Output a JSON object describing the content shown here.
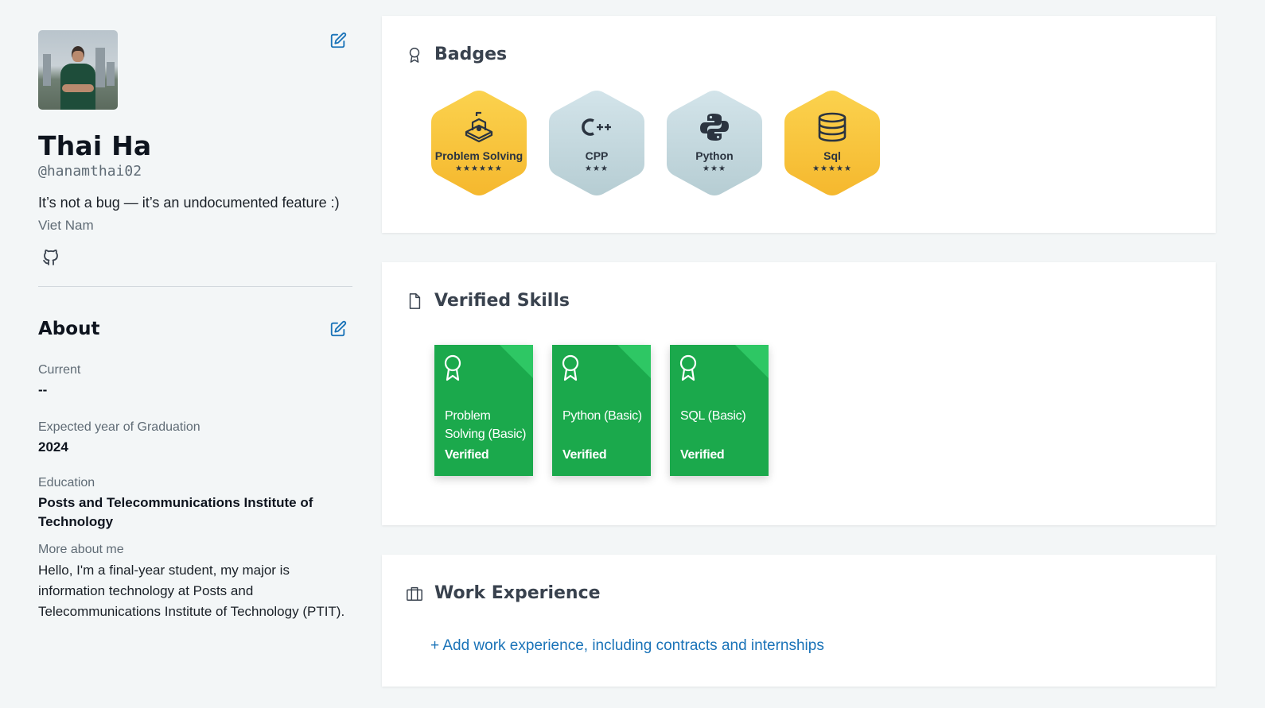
{
  "profile": {
    "name": "Thai Ha",
    "handle": "@hanamthai02",
    "bio": "It’s not a bug — it’s an undocumented feature :)",
    "location": "Viet Nam",
    "social_icon": "github-icon",
    "edit_icon": "edit-icon"
  },
  "about": {
    "title": "About",
    "current_label": "Current",
    "current_value": "--",
    "graduation_label": "Expected year of Graduation",
    "graduation_value": "2024",
    "education_label": "Education",
    "education_value": "Posts and Telecommunications Institute of Technology",
    "more_label": "More about me",
    "more_value": "Hello, I'm a final-year student, my major is information technology at Posts and Telecommunications Institute of Technology (PTIT)."
  },
  "badges": {
    "title": "Badges",
    "icon": "award-icon",
    "items": [
      {
        "name": "Problem Solving",
        "stars": 6,
        "star_text": "★★★★★★",
        "tier": "gold",
        "icon": "problem-solving-icon"
      },
      {
        "name": "CPP",
        "stars": 3,
        "star_text": "★★★",
        "tier": "silver",
        "icon": "cpp-icon"
      },
      {
        "name": "Python",
        "stars": 3,
        "star_text": "★★★",
        "tier": "silver",
        "icon": "python-icon"
      },
      {
        "name": "Sql",
        "stars": 5,
        "star_text": "★★★★★",
        "tier": "gold",
        "icon": "database-icon"
      }
    ]
  },
  "verified_skills": {
    "title": "Verified Skills",
    "icon": "document-icon",
    "items": [
      {
        "name": "Problem Solving (Basic)",
        "status": "Verified"
      },
      {
        "name": "Python (Basic)",
        "status": "Verified"
      },
      {
        "name": "SQL (Basic)",
        "status": "Verified"
      }
    ]
  },
  "work_experience": {
    "title": "Work Experience",
    "icon": "briefcase-icon",
    "add_link": "+ Add work experience, including contracts and internships"
  },
  "colors": {
    "gold": "#f7c23b",
    "silver": "#c6dbe2",
    "skill_green": "#1ba94c",
    "link_blue": "#1a73b8",
    "page_bg": "#f3f6f7"
  }
}
